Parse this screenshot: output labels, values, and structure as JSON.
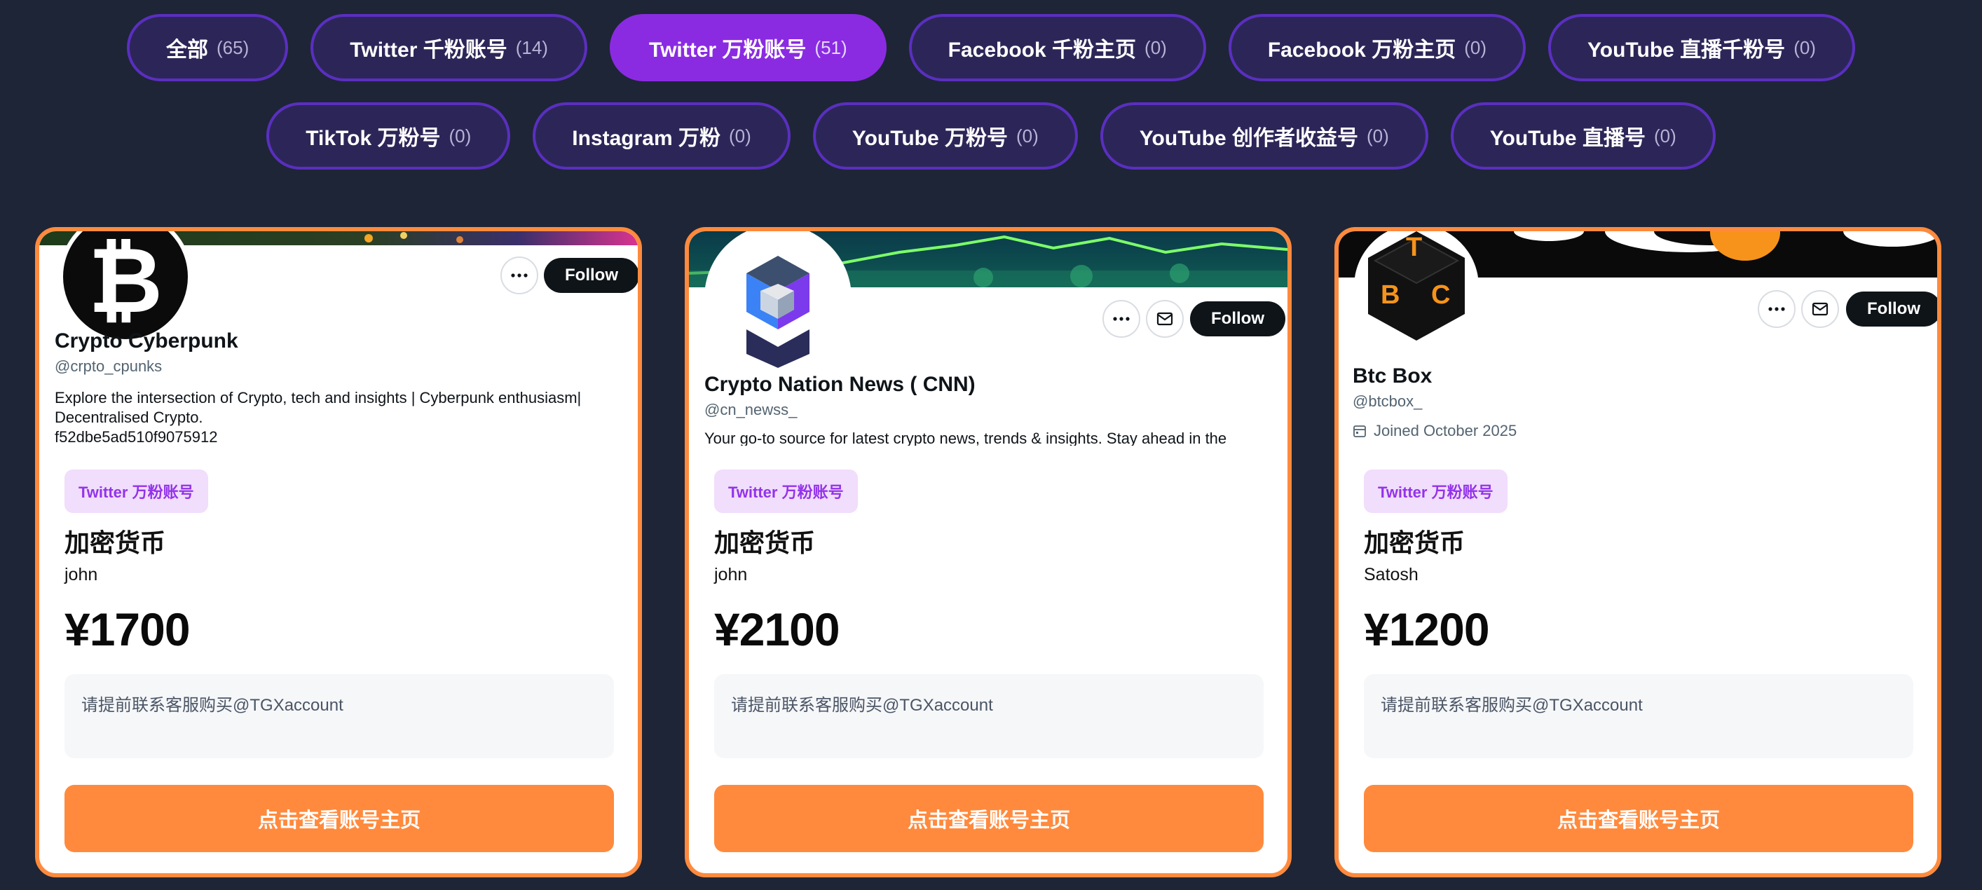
{
  "filters": {
    "row1": [
      {
        "label": "全部",
        "count": "(65)",
        "active": false
      },
      {
        "label": "Twitter 千粉账号",
        "count": "(14)",
        "active": false
      },
      {
        "label": "Twitter 万粉账号",
        "count": "(51)",
        "active": true
      },
      {
        "label": "Facebook 千粉主页",
        "count": "(0)",
        "active": false
      },
      {
        "label": "Facebook 万粉主页",
        "count": "(0)",
        "active": false
      },
      {
        "label": "YouTube 直播千粉号",
        "count": "(0)",
        "active": false
      }
    ],
    "row2": [
      {
        "label": "TikTok 万粉号",
        "count": "(0)",
        "active": false
      },
      {
        "label": "Instagram 万粉",
        "count": "(0)",
        "active": false
      },
      {
        "label": "YouTube 万粉号",
        "count": "(0)",
        "active": false
      },
      {
        "label": "YouTube 创作者收益号",
        "count": "(0)",
        "active": false
      },
      {
        "label": "YouTube 直播号",
        "count": "(0)",
        "active": false
      }
    ]
  },
  "cards": [
    {
      "profile": {
        "name": "Crypto Cyberpunk",
        "handle": "@crpto_cpunks",
        "bio_line1": "Explore the intersection of Crypto, tech and insights | Cyberpunk enthusiasm|",
        "bio_line2": "Decentralised Crypto.",
        "bio_line3": "f52dbe5ad510f9075912",
        "follow_label": "Follow",
        "avatar_glyph": "₿"
      },
      "tag": "Twitter 万粉账号",
      "category": "加密货币",
      "seller": "john",
      "price": "¥1700",
      "notice": "请提前联系客服购买@TGXaccount",
      "cta": "点击查看账号主页"
    },
    {
      "profile": {
        "name": "Crypto Nation News ( CNN)",
        "handle": "@cn_newss_",
        "bio_line1": "Your go-to source for latest crypto news, trends & insights. Stay ahead in the",
        "follow_label": "Follow"
      },
      "tag": "Twitter 万粉账号",
      "category": "加密货币",
      "seller": "john",
      "price": "¥2100",
      "notice": "请提前联系客服购买@TGXaccount",
      "cta": "点击查看账号主页"
    },
    {
      "profile": {
        "name": "Btc Box",
        "handle": "@btcbox_",
        "joined": "Joined October 2025",
        "follow_label": "Follow",
        "avatar_letters": [
          "T",
          "B",
          "C"
        ]
      },
      "tag": "Twitter 万粉账号",
      "category": "加密货币",
      "seller": "Satosh",
      "price": "¥1200",
      "notice": "请提前联系客服购买@TGXaccount",
      "cta": "点击查看账号主页"
    }
  ],
  "colors": {
    "background": "#1e2536",
    "pill": "#2c2658",
    "pill_active": "#8a2be2",
    "card_border": "#ff8a3d",
    "cta": "#ff8a3d",
    "tag_bg": "#f1ddfc",
    "tag_text": "#9333ea"
  }
}
